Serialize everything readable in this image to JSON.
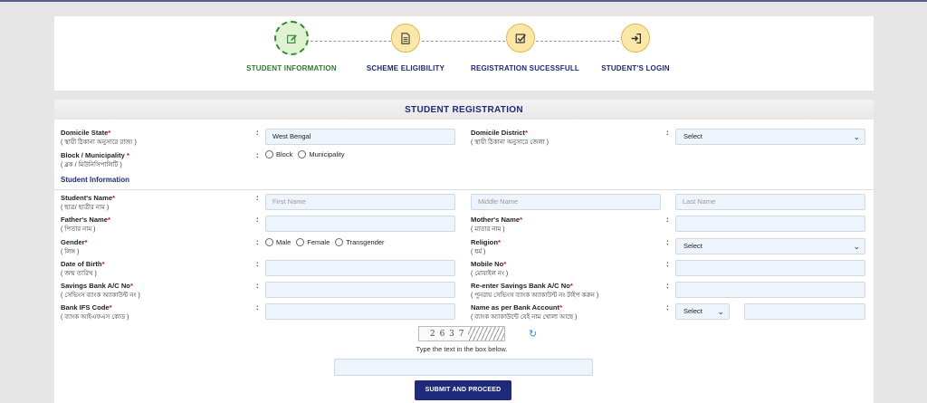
{
  "stepper": {
    "steps": [
      {
        "label": "STUDENT INFORMATION",
        "icon": "edit-icon",
        "active": true
      },
      {
        "label": "SCHEME ELIGIBILITY",
        "icon": "document-icon",
        "active": false
      },
      {
        "label": "REGISTRATION SUCESSFULL",
        "icon": "checkbox-icon",
        "active": false
      },
      {
        "label": "STUDENT'S LOGIN",
        "icon": "login-icon",
        "active": false
      }
    ]
  },
  "form": {
    "title": "STUDENT REGISTRATION",
    "domicile_state": {
      "label": "Domicile State",
      "bn": "( স্থায়ী ঠিকানা অনুসারে রাজ্য )",
      "value": "West Bengal"
    },
    "domicile_district": {
      "label": "Domicile District",
      "bn": "( স্থায়ী ঠিকানা অনুসারে জেলা )",
      "value": "Select"
    },
    "block": {
      "label": "Block / Municipality",
      "bn": "( ব্লক / মিউনিসিপালিটি )",
      "options": [
        "Block",
        "Municipality"
      ]
    },
    "section_title": "Student Information",
    "student_name": {
      "label": "Student's Name",
      "bn": "( ছাত্র/ ছাত্রীর নাম )",
      "first_ph": "First Name",
      "middle_ph": "Middle Name",
      "last_ph": "Last Name"
    },
    "father_name": {
      "label": "Father's Name",
      "bn": "( পিতার নাম )"
    },
    "mother_name": {
      "label": "Mother's Name",
      "bn": "( মাতার নাম )"
    },
    "gender": {
      "label": "Gender",
      "bn": "( লিঙ্গ )",
      "options": [
        "Male",
        "Female",
        "Transgender"
      ]
    },
    "religion": {
      "label": "Religion",
      "bn": "( ধর্ম )",
      "value": "Select"
    },
    "dob": {
      "label": "Date of Birth",
      "bn": "( জন্ম তারিখ )"
    },
    "mobile": {
      "label": "Mobile No",
      "bn": "( মোবাইল নং )"
    },
    "savings": {
      "label": "Savings Bank A/C No",
      "bn": "( সেভিংস ব্যাংক অ্যাকাউন্ট নং )"
    },
    "resavings": {
      "label": "Re-enter Savings Bank A/C No",
      "bn": "( পুনরায় সেভিংস ব্যাংক অ্যাকাউন্ট নং টাইপ করুন )"
    },
    "ifsc": {
      "label": "Bank IFS Code",
      "bn": "( ব্যাংক আইএফএস কোড )"
    },
    "name_bank": {
      "label": "Name as per Bank Account",
      "bn": "( ব্যাংক অ্যাকাউন্টে যেই নাম খোলা আছে )",
      "value": "Select"
    },
    "captcha_text": "2 6 3 7 5 9",
    "captcha_hint": "Type the text in the box below.",
    "submit_label": "SUBMIT AND PROCEED"
  }
}
